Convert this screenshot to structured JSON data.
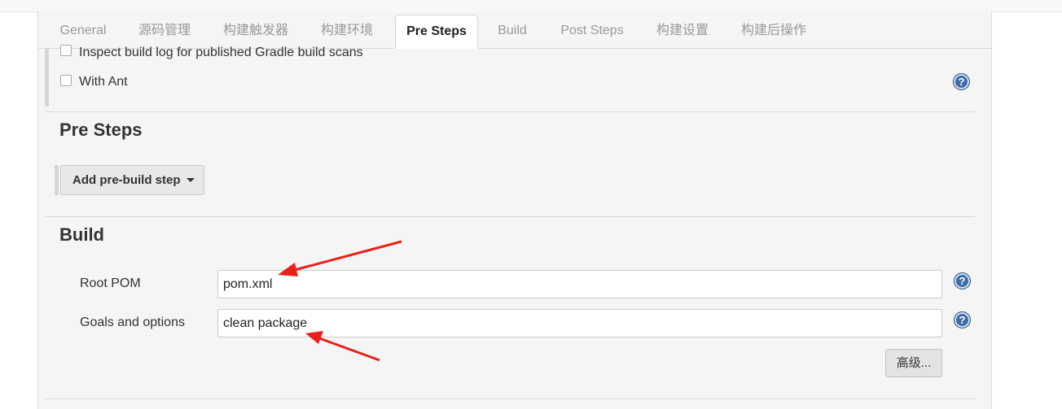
{
  "tabs": [
    {
      "label": "General",
      "active": false
    },
    {
      "label": "源码管理",
      "active": false
    },
    {
      "label": "构建触发器",
      "active": false
    },
    {
      "label": "构建环境",
      "active": false
    },
    {
      "label": "Pre Steps",
      "active": true
    },
    {
      "label": "Build",
      "active": false
    },
    {
      "label": "Post Steps",
      "active": false
    },
    {
      "label": "构建设置",
      "active": false
    },
    {
      "label": "构建后操作",
      "active": false
    }
  ],
  "options": {
    "inspect_log_label": "Inspect build log for published Gradle build scans",
    "with_ant_label": "With Ant"
  },
  "pre_steps": {
    "title": "Pre Steps",
    "add_step_label": "Add pre-build step"
  },
  "build": {
    "title": "Build",
    "root_pom_label": "Root POM",
    "root_pom_value": "pom.xml",
    "goals_label": "Goals and options",
    "goals_value": "clean package",
    "advanced_label": "高级..."
  },
  "help_glyph": "?",
  "colors": {
    "annotation_arrow": "#e8211a",
    "help_icon": "#3d6ca6",
    "panel_bg": "#f5f5f5"
  }
}
